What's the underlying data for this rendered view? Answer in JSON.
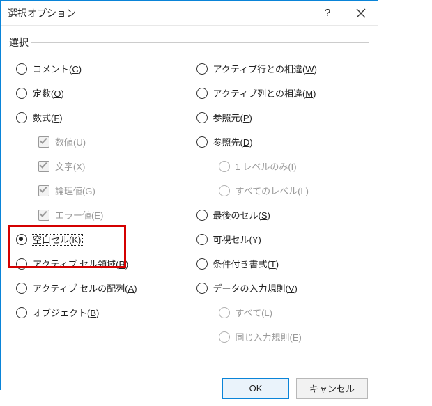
{
  "titlebar": {
    "title": "選択オプション"
  },
  "group": {
    "legend": "選択"
  },
  "left": {
    "comment": {
      "text": "コメント(",
      "accel": "C",
      "tail": ")"
    },
    "constants": {
      "text": "定数(",
      "accel": "O",
      "tail": ")"
    },
    "formulas": {
      "text": "数式(",
      "accel": "F",
      "tail": ")"
    },
    "num": {
      "text": "数値(U)"
    },
    "txt": {
      "text": "文字(X)"
    },
    "logic": {
      "text": "論理値(G)"
    },
    "err": {
      "text": "エラー値(E)"
    },
    "blanks": {
      "text": "空白セル(",
      "accel": "K",
      "tail": ")"
    },
    "curregion": {
      "text": "アクティブ セル領域(",
      "accel": "R",
      "tail": ")"
    },
    "curarray": {
      "text": "アクティブ セルの配列(",
      "accel": "A",
      "tail": ")"
    },
    "objects": {
      "text": "オブジェクト(",
      "accel": "B",
      "tail": ")"
    }
  },
  "right": {
    "rowdiff": {
      "text": "アクティブ行との相違(",
      "accel": "W",
      "tail": ")"
    },
    "coldiff": {
      "text": "アクティブ列との相違(",
      "accel": "M",
      "tail": ")"
    },
    "precedents": {
      "text": "参照元(",
      "accel": "P",
      "tail": ")"
    },
    "dependents": {
      "text": "参照先(",
      "accel": "D",
      "tail": ")"
    },
    "onelevel": {
      "text": "1 レベルのみ(I)"
    },
    "alllevels": {
      "text": "すべてのレベル(L)"
    },
    "lastcell": {
      "text": "最後のセル(",
      "accel": "S",
      "tail": ")"
    },
    "visible": {
      "text": "可視セル(",
      "accel": "Y",
      "tail": ")"
    },
    "condfmt": {
      "text": "条件付き書式(",
      "accel": "T",
      "tail": ")"
    },
    "validation": {
      "text": "データの入力規則(",
      "accel": "V",
      "tail": ")"
    },
    "all": {
      "text": "すべて(L)"
    },
    "same": {
      "text": "同じ入力規則(E)"
    }
  },
  "buttons": {
    "ok": "OK",
    "cancel": "キャンセル"
  }
}
